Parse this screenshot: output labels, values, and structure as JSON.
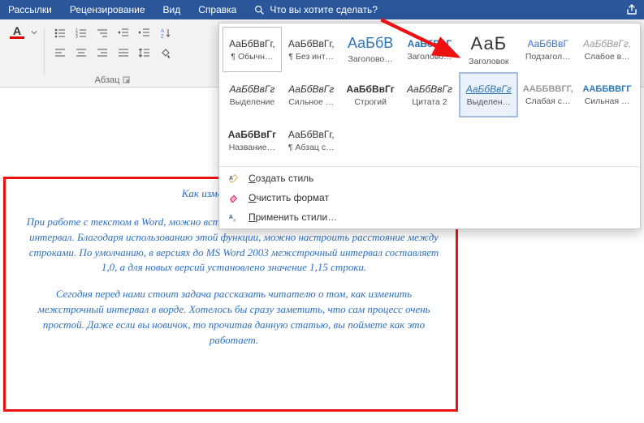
{
  "tabs": {
    "mailings": "Рассылки",
    "review": "Рецензирование",
    "view": "Вид",
    "help": "Справка",
    "tellme": "Что вы хотите сделать?"
  },
  "ribbon": {
    "paragraph_caption": "Абзац"
  },
  "styles": {
    "row1": [
      {
        "preview": "АаБбВвГг,",
        "name": "¶ Обычн…",
        "cls": "pv-normal",
        "boxed": true
      },
      {
        "preview": "АаБбВвГг,",
        "name": "¶ Без инт…",
        "cls": "pv-normal"
      },
      {
        "preview": "АаБбВ",
        "name": "Заголово…",
        "cls": "pv-bigblue"
      },
      {
        "preview": "АаБбВвГ",
        "name": "Заголово…",
        "cls": "pv-boldblue"
      },
      {
        "preview": "АаБ",
        "name": "Заголовок",
        "cls": "pv-huge"
      },
      {
        "preview": "АаБбВвГ",
        "name": "Подзагол…",
        "cls": "pv-bluegray"
      },
      {
        "preview": "АаБбВвГг,",
        "name": "Слабое в…",
        "cls": "pv-gray pv-italic"
      }
    ],
    "row2": [
      {
        "preview": "АаБбВвГг",
        "name": "Выделение",
        "cls": "pv-italic"
      },
      {
        "preview": "АаБбВвГг",
        "name": "Сильное …",
        "cls": "pv-blue pv-italic"
      },
      {
        "preview": "АаБбВвГг",
        "name": "Строгий",
        "cls": "pv-bold"
      },
      {
        "preview": "АаБбВвГг",
        "name": "Цитата 2",
        "cls": "pv-italic pv-blue"
      },
      {
        "preview": "АаБбВвГг",
        "name": "Выделен…",
        "cls": "pv-blueul",
        "sel": true
      },
      {
        "preview": "ААББВВГГ,",
        "name": "Слабая с…",
        "cls": "pv-caps pv-gray"
      },
      {
        "preview": "ААББВВГГ",
        "name": "Сильная …",
        "cls": "pv-caps"
      }
    ],
    "row3": [
      {
        "preview": "АаБбВвГг",
        "name": "Название…",
        "cls": "pv-bold"
      },
      {
        "preview": "АаБбВвГг,",
        "name": "¶ Абзац с…",
        "cls": "pv-normal"
      }
    ],
    "menu": {
      "create": "Создать стиль",
      "clear": "Очистить формат",
      "apply": "Применить стили…"
    }
  },
  "doc": {
    "title": "Как изменить межстр",
    "p1": "При работе с текстом в Word, можно встретиться с таким понятием, как межстрочный интервал. Благодаря использованию этой функции, можно настроить расстояние между строками. По умолчанию, в версиях до MS Word 2003 межстрочный интервал составляет 1,0, а для новых версий установлено значение 1,15 строки.",
    "p2": "Сегодня перед нами стоит задача рассказать читателю о том, как изменить межстрочный интервал в ворде. Хотелось бы сразу заметить, что сам процесс очень простой. Даже если вы новичок, то прочитав данную статью, вы поймете как это работает."
  }
}
